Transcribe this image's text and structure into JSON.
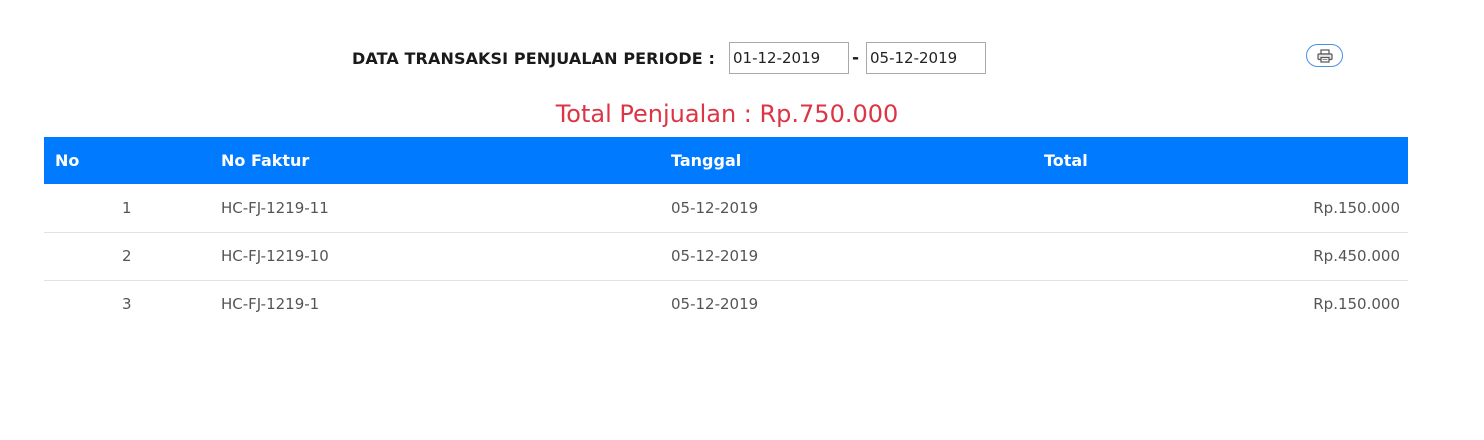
{
  "filter": {
    "label": "DATA TRANSAKSI PENJUALAN PERIODE :",
    "date_from": "01-12-2019",
    "separator": "-",
    "date_to": "05-12-2019"
  },
  "print_button": {
    "icon": "printer-icon",
    "color": "#4a90e2"
  },
  "summary": {
    "total_text": "Total Penjualan : Rp.750.000",
    "color": "#dc3545"
  },
  "table": {
    "header_color": "#007bff",
    "columns": [
      "No",
      "No Faktur",
      "Tanggal",
      "Total"
    ],
    "rows": [
      {
        "no": "1",
        "faktur": "HC-FJ-1219-11",
        "tanggal": "05-12-2019",
        "total": "Rp.150.000"
      },
      {
        "no": "2",
        "faktur": "HC-FJ-1219-10",
        "tanggal": "05-12-2019",
        "total": "Rp.450.000"
      },
      {
        "no": "3",
        "faktur": "HC-FJ-1219-1",
        "tanggal": "05-12-2019",
        "total": "Rp.150.000"
      }
    ]
  }
}
